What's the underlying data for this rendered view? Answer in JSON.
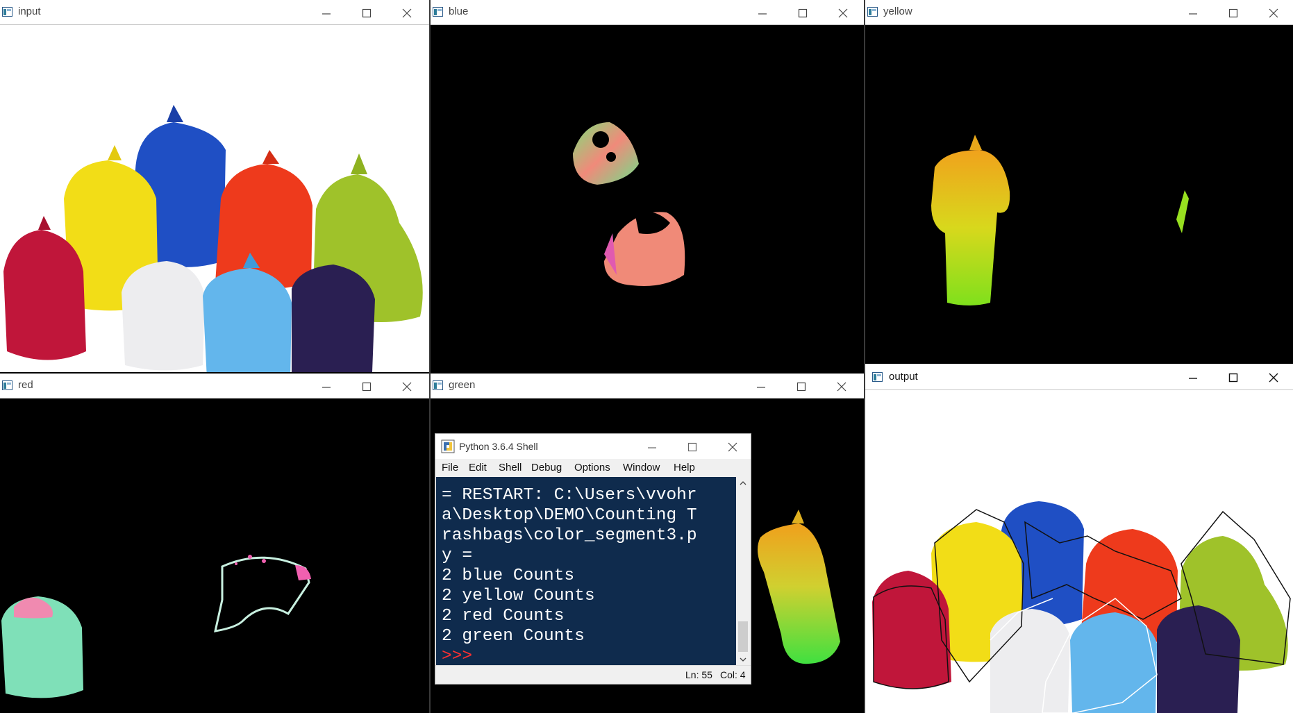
{
  "windows": {
    "input": {
      "title": "input"
    },
    "blue": {
      "title": "blue"
    },
    "yellow": {
      "title": "yellow"
    },
    "red": {
      "title": "red"
    },
    "green": {
      "title": "green"
    },
    "output": {
      "title": "output"
    }
  },
  "shell": {
    "title": "Python 3.6.4 Shell",
    "menu": [
      "File",
      "Edit",
      "Shell",
      "Debug",
      "Options",
      "Window",
      "Help"
    ],
    "lines": [
      "= RESTART: C:\\Users\\vvohr",
      "a\\Desktop\\DEMO\\Counting T",
      "rashbags\\color_segment3.p",
      "y =",
      "2 blue Counts",
      "2 yellow Counts",
      "2 red Counts",
      "2 green Counts"
    ],
    "prompt": ">>>",
    "status_ln": "Ln: 55",
    "status_col": "Col: 4"
  },
  "colors": {
    "bag_red": "#c0163a",
    "bag_yellow": "#f2dd17",
    "bag_blue": "#1f4fc4",
    "bag_orange": "#ee3a1c",
    "bag_green": "#9fc22a",
    "bag_white": "#ededef",
    "bag_lightblue": "#63b6ec",
    "bag_purple": "#2a1f52",
    "shell_bg": "#0f2b4d"
  },
  "icons": [
    "window-icon",
    "minimize-icon",
    "maximize-icon",
    "close-icon",
    "python-icon"
  ]
}
